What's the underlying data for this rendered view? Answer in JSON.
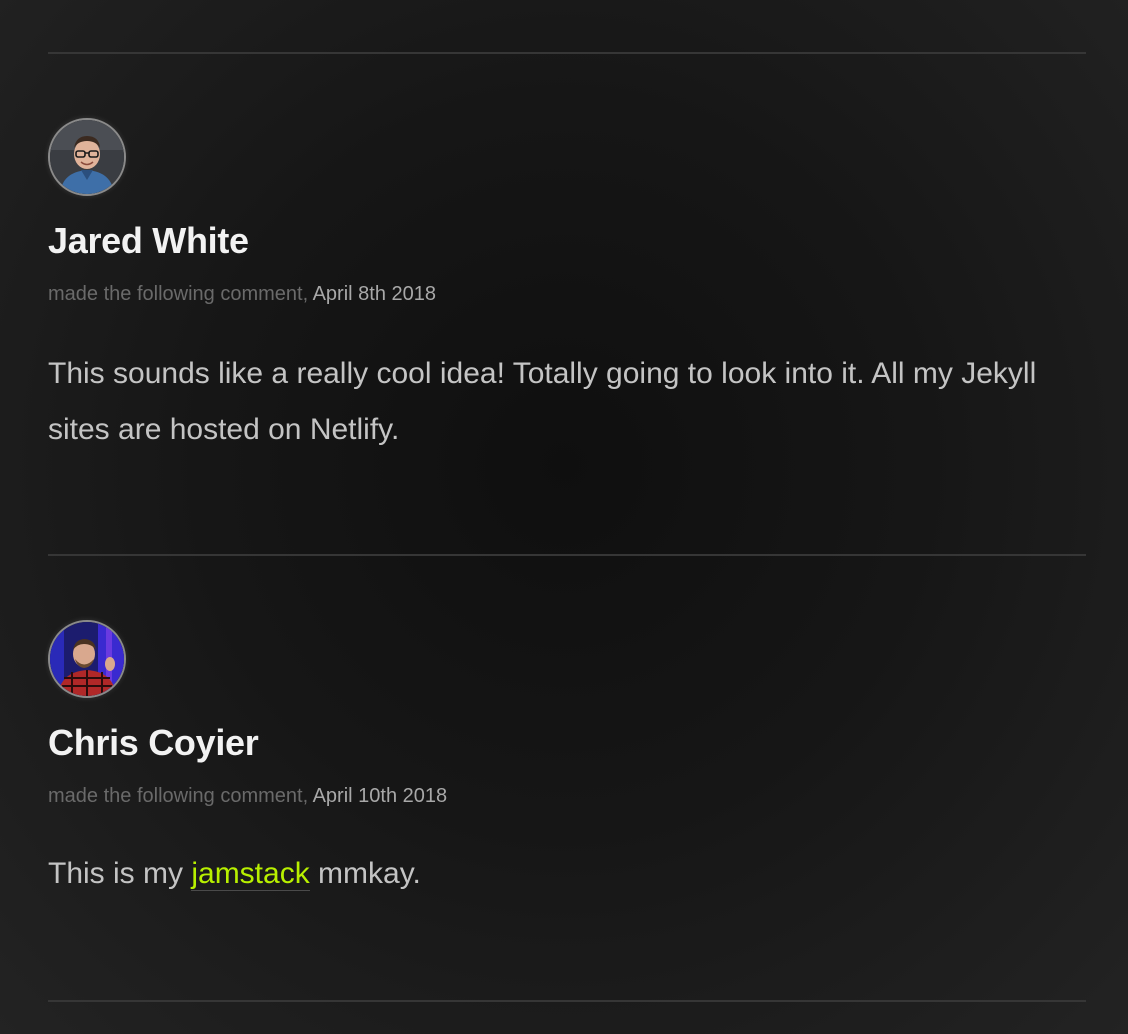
{
  "comments": [
    {
      "author": "Jared White",
      "meta_prefix": "made the following comment,",
      "date": "April 8th 2018",
      "body": "This sounds like a really cool idea! Totally going to look into it. All my Jekyll sites are hosted on Netlify."
    },
    {
      "author": "Chris Coyier",
      "meta_prefix": "made the following comment,",
      "date": "April 10th 2018",
      "body_before": "This is my",
      "body_link": "jamstack",
      "body_after": "mmkay."
    }
  ],
  "colors": {
    "link": "#b8f000",
    "divider": "#363636"
  }
}
